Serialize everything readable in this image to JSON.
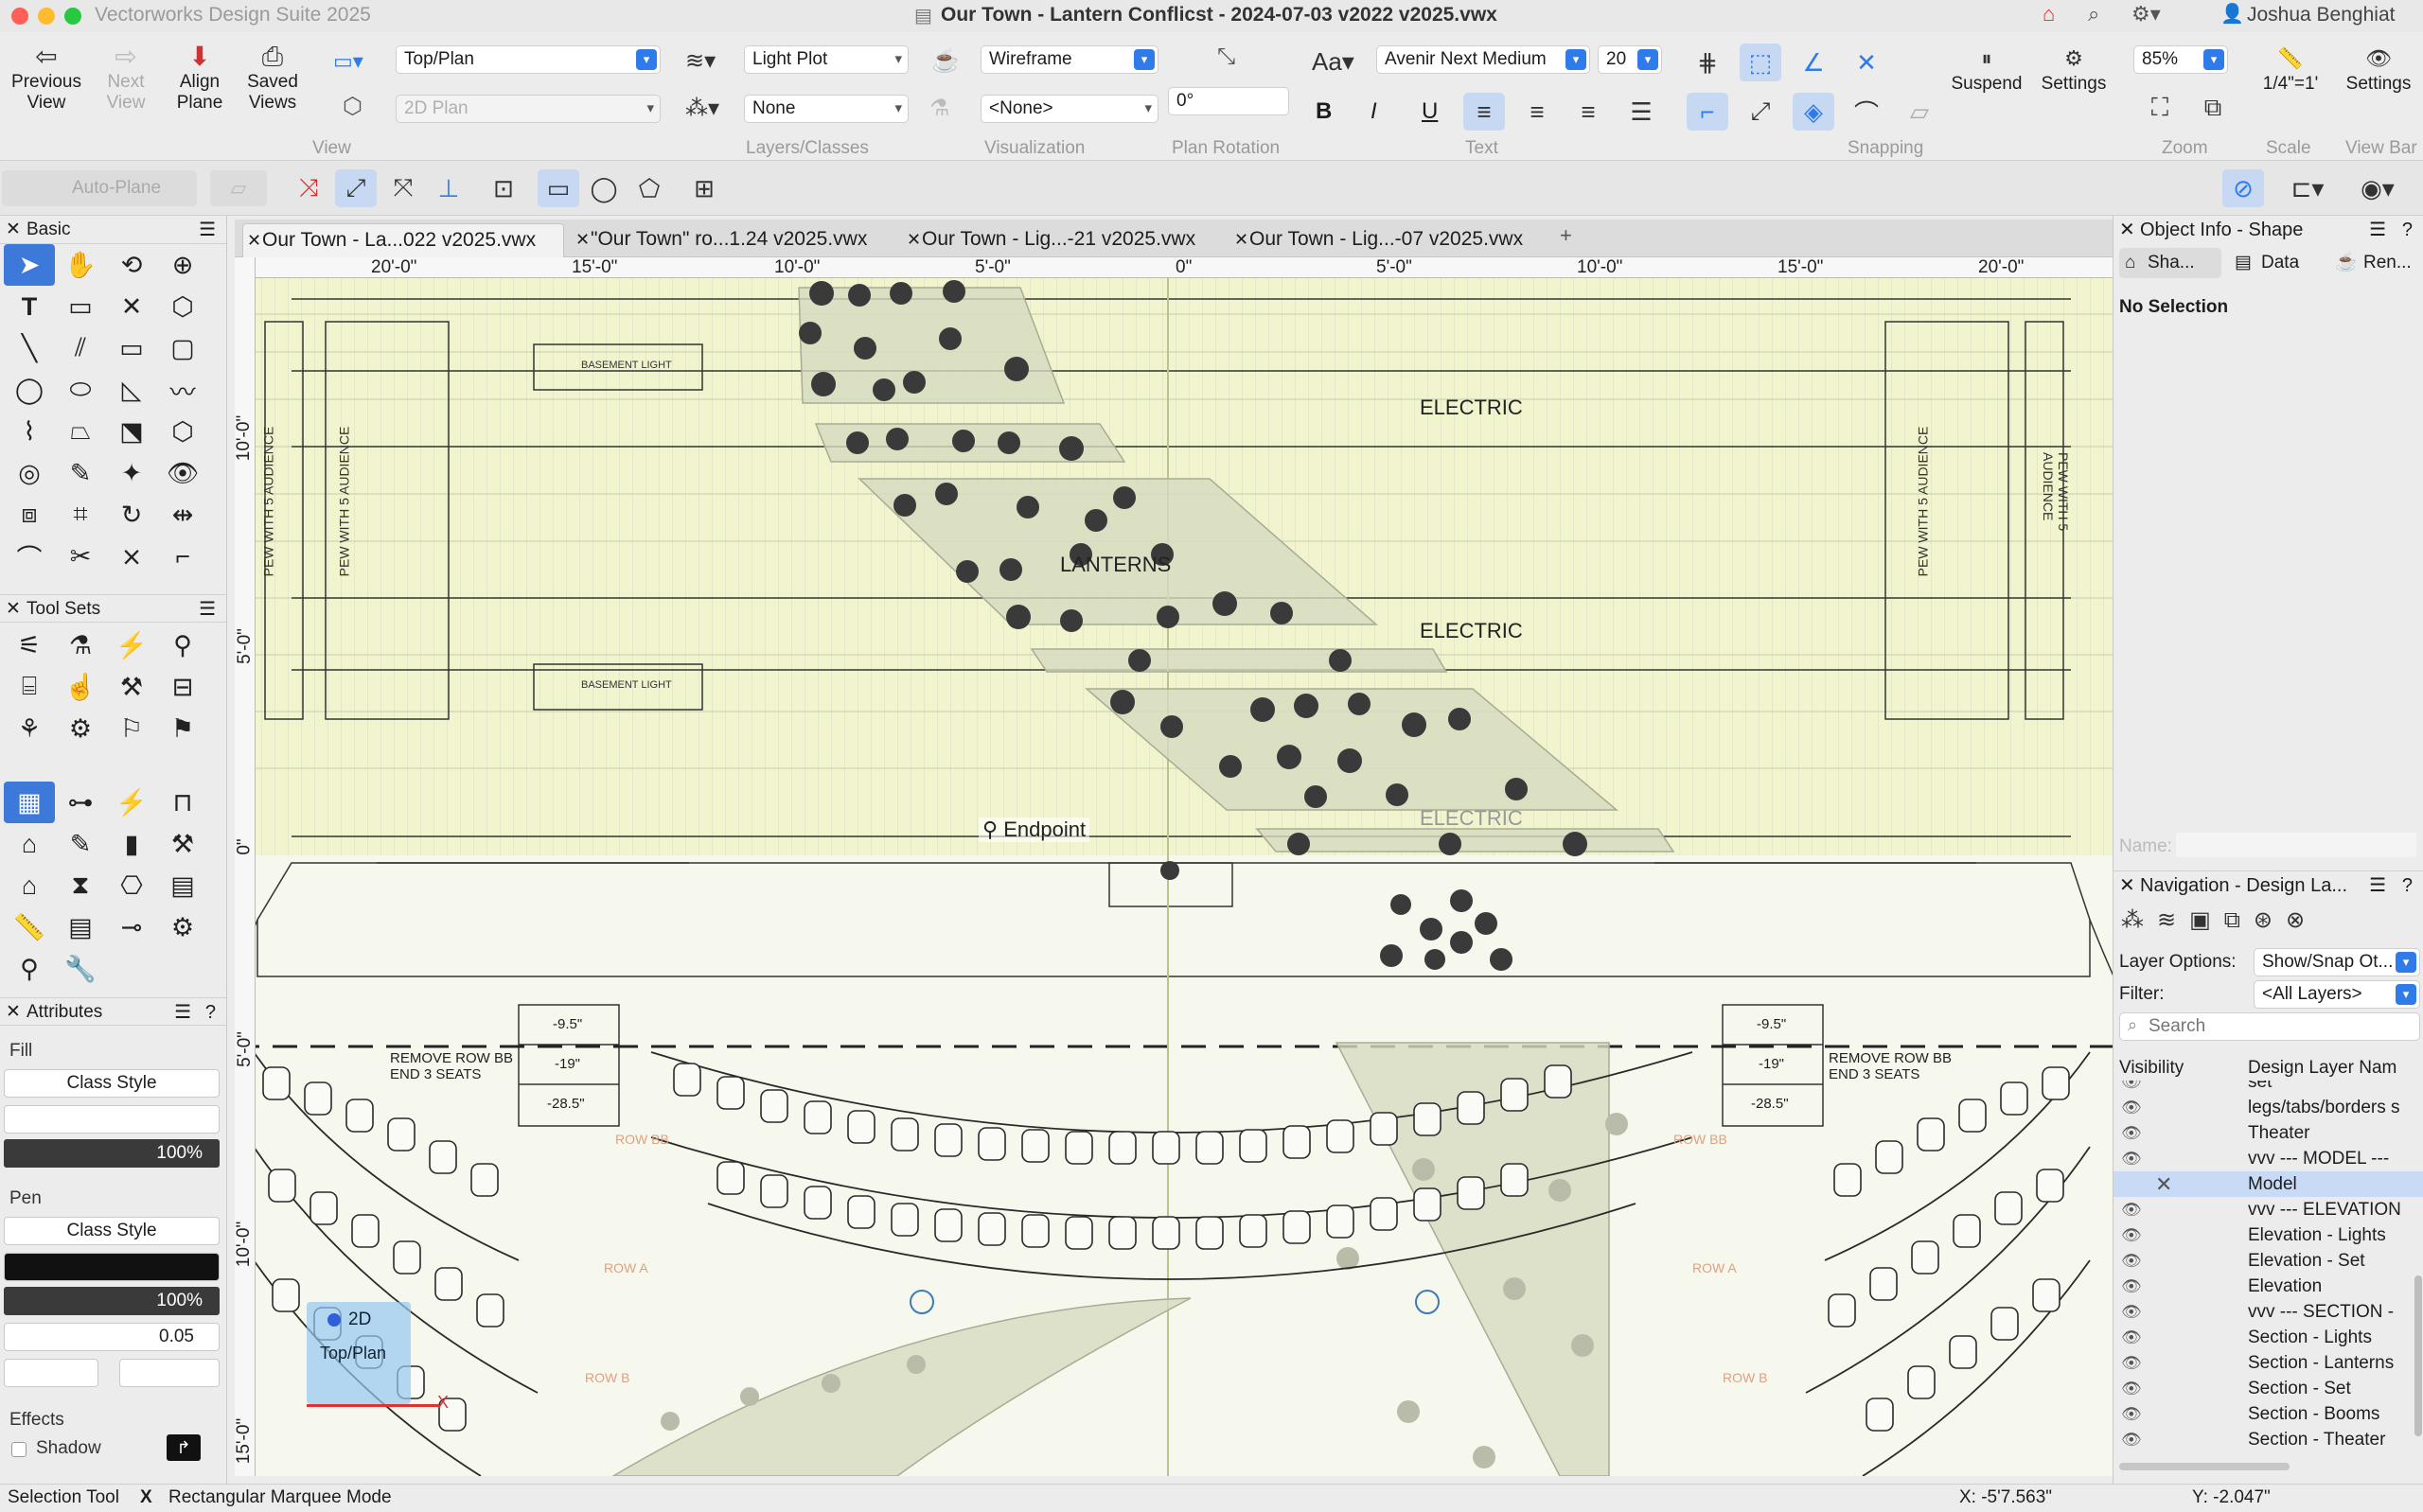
{
  "window": {
    "app_name": "Vectorworks Design Suite 2025",
    "document_title": "Our Town - Lantern Conflicst - 2024-07-03 v2022 v2025.vwx",
    "user": "Joshua Benghiat"
  },
  "toolbar": {
    "view_group": {
      "label": "View",
      "previous": "Previous\nView",
      "next": "Next\nView",
      "align_plane": "Align\nPlane",
      "saved_views": "Saved\nViews",
      "view_select": "Top/Plan",
      "render_select": "2D Plan"
    },
    "layers_group": {
      "label": "Layers/Classes",
      "layer": "Light Plot",
      "class": "None"
    },
    "visualization_group": {
      "label": "Visualization",
      "mode": "Wireframe",
      "style": "<None>"
    },
    "rotation_group": {
      "label": "Plan Rotation",
      "value": "0°"
    },
    "text_group": {
      "label": "Text",
      "font": "Avenir Next Medium",
      "size": "20",
      "bold": "B",
      "italic": "I",
      "underline": "U"
    },
    "snapping_group": {
      "label": "Snapping",
      "suspend": "Suspend",
      "settings": "Settings"
    },
    "zoom_group": {
      "label": "Zoom",
      "value": "85%"
    },
    "scale_group": {
      "label": "Scale",
      "value": "1/4\"=1'"
    },
    "viewbar_group": {
      "label": "View Bar",
      "settings": "Settings"
    },
    "auto_plane": "Auto-Plane"
  },
  "tool_palettes": {
    "basic_title": "Basic",
    "toolsets_title": "Tool Sets"
  },
  "attributes": {
    "title": "Attributes",
    "fill_label": "Fill",
    "fill_style": "Class Style",
    "fill_opacity": "100%",
    "pen_label": "Pen",
    "pen_style": "Class Style",
    "pen_opacity": "100%",
    "line_weight": "0.05",
    "effects_label": "Effects",
    "shadow_label": "Shadow"
  },
  "tabs": [
    {
      "label": "Our Town - La...022 v2025.vwx"
    },
    {
      "label": "\"Our Town\" ro...1.24 v2025.vwx"
    },
    {
      "label": "Our Town - Lig...-21 v2025.vwx"
    },
    {
      "label": "Our Town - Lig...-07 v2025.vwx"
    }
  ],
  "ruler": {
    "h": [
      "20'-0\"",
      "15'-0\"",
      "10'-0\"",
      "5'-0\"",
      "0\"",
      "5'-0\"",
      "10'-0\"",
      "15'-0\"",
      "20'-0\""
    ],
    "v": [
      "10'-0\"",
      "5'-0\"",
      "0\"",
      "5'-0\"",
      "10'-0\"",
      "15'-0\""
    ]
  },
  "drawing": {
    "basement_light": "BASEMENT LIGHT",
    "electric": "ELECTRIC",
    "lanterns": "LANTERNS",
    "pew_audience": "PEW WITH 5 AUDIENCE",
    "endpoint": "Endpoint",
    "remove_row": "REMOVE ROW BB",
    "end_seats": "END 3 SEATS",
    "dim1": "-9.5\"",
    "dim2": "-19\"",
    "dim3": "-28.5\"",
    "row_bb": "ROW BB",
    "row_a": "ROW A",
    "row_b": "ROW B",
    "plane_2d": "2D",
    "plane_view": "Top/Plan",
    "axis_x": "X"
  },
  "object_info": {
    "title": "Object Info - Shape",
    "tab_shape": "Sha...",
    "tab_data": "Data",
    "tab_render": "Ren...",
    "selection": "No Selection",
    "name_label": "Name:"
  },
  "navigation": {
    "title": "Navigation - Design La...",
    "layer_options_label": "Layer Options:",
    "layer_options_value": "Show/Snap Ot...",
    "filter_label": "Filter:",
    "filter_value": "<All Layers>",
    "search_placeholder": "Search",
    "col_visibility": "Visibility",
    "col_name": "Design Layer Nam",
    "layers": [
      "set",
      "legs/tabs/borders s",
      "Theater",
      "vvv --- MODEL ---",
      "Model",
      "vvv --- ELEVATION",
      "Elevation - Lights",
      "Elevation - Set",
      "Elevation",
      "vvv --- SECTION -",
      "Section - Lights",
      "Section - Lanterns",
      "Section - Set",
      "Section - Booms",
      "Section - Theater"
    ]
  },
  "status": {
    "tool": "Selection Tool",
    "mode_icon": "X",
    "mode": "Rectangular Marquee Mode",
    "x": "X: -5'7.563\"",
    "y": "Y: -2.047\""
  },
  "colors": {
    "accent": "#2f7bea",
    "selected": "#c8daf5",
    "drawing_bg": "#f6f8ee",
    "stage_yellow": "#f1f4cc"
  }
}
